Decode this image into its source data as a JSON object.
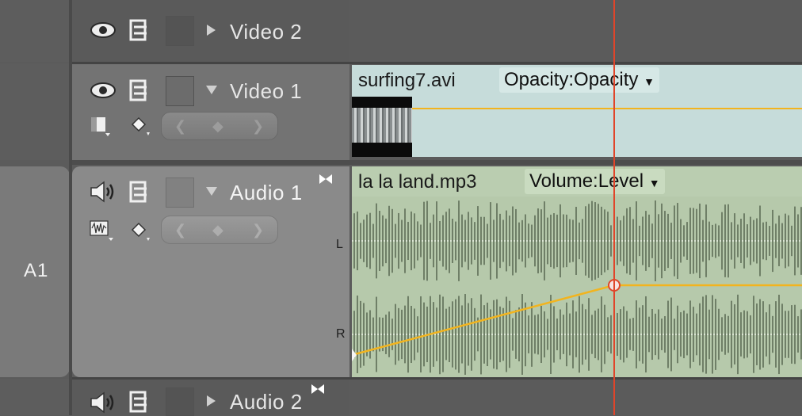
{
  "tracks": {
    "video2": {
      "name": "Video 2"
    },
    "video1": {
      "name": "Video 1"
    },
    "audio1": {
      "name": "Audio 1",
      "patch_label": "A1",
      "channel_left": "L",
      "channel_right": "R"
    },
    "audio2": {
      "name": "Audio 2"
    }
  },
  "clips": {
    "video": {
      "name": "surfing7.avi",
      "property": "Opacity:Opacity"
    },
    "audio": {
      "name": "la la land.mp3",
      "property": "Volume:Level"
    }
  },
  "colors": {
    "playhead": "#e0452a",
    "rubberband": "#f2b41e",
    "video_clip": "#c6dcda",
    "audio_clip": "#b6c9ab",
    "waveform": "#6f7f67"
  },
  "icons": {
    "toggle_output": "eye-icon",
    "toggle_audio": "speaker-icon",
    "sync_lock": "sync-lock-icon",
    "track_lock": "lock-box",
    "keyframe": "diamond-icon"
  }
}
